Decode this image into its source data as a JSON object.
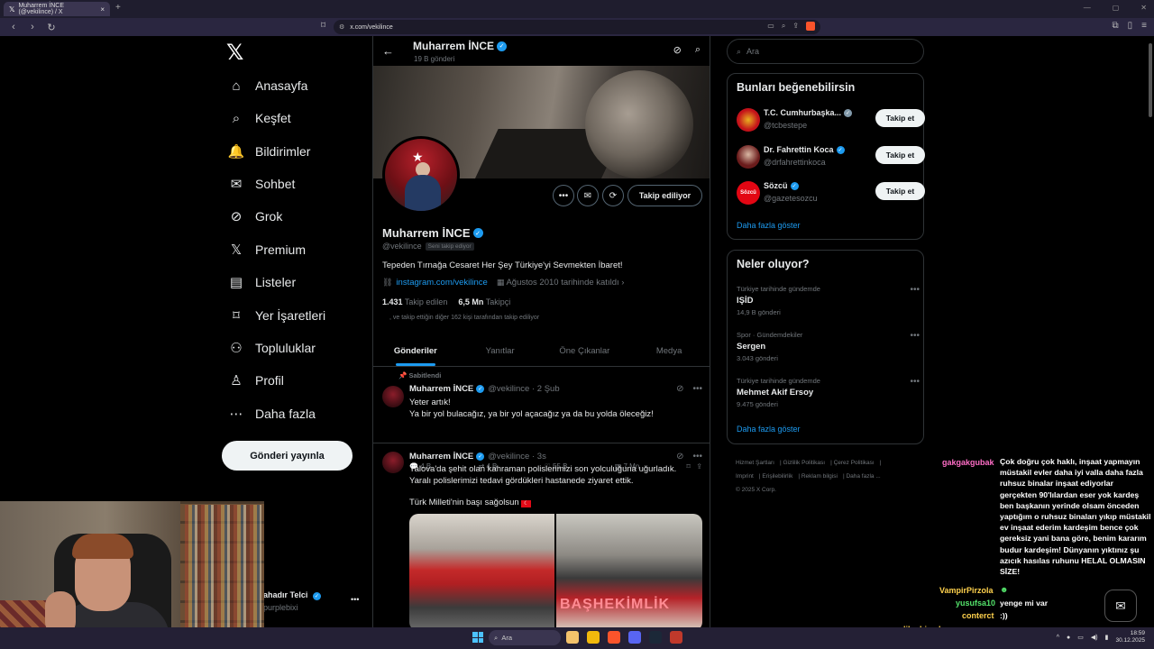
{
  "browser": {
    "tab_title": "Muharrem İNCE (@vekilince) / X",
    "url": "x.com/vekilince"
  },
  "nav": {
    "items": [
      {
        "label": "Anasayfa",
        "icon": "home-icon"
      },
      {
        "label": "Keşfet",
        "icon": "search-icon"
      },
      {
        "label": "Bildirimler",
        "icon": "bell-icon"
      },
      {
        "label": "Sohbet",
        "icon": "mail-icon"
      },
      {
        "label": "Grok",
        "icon": "grok-icon"
      },
      {
        "label": "Premium",
        "icon": "x-icon"
      },
      {
        "label": "Listeler",
        "icon": "list-icon"
      },
      {
        "label": "Yer İşaretleri",
        "icon": "bookmark-icon"
      },
      {
        "label": "Topluluklar",
        "icon": "community-icon"
      },
      {
        "label": "Profil",
        "icon": "person-icon"
      },
      {
        "label": "Daha fazla",
        "icon": "more-circle-icon"
      }
    ],
    "post_label": "Gönderi yayınla",
    "account_name": "ahadır Telci",
    "account_handle": "purplebixi"
  },
  "profile": {
    "name": "Muharrem İNCE",
    "posts_count": "19 B gönderi",
    "handle": "@vekilince",
    "follows_you": "Seni takip ediyor",
    "follow_label": "Takip ediliyor",
    "bio": "Tepeden Tırnağa Cesaret Her Şey Türkiye'yi Sevmekten İbaret!",
    "link": "instagram.com/vekilince",
    "joined": "Ağustos 2010 tarihinde katıldı",
    "following_count": "1.431",
    "following_label": "Takip edilen",
    "followers_count": "6,5 Mn",
    "followers_label": "Takipçi",
    "followed_by": ", ve takip ettiğin diğer 162 kişi tarafından takip ediliyor"
  },
  "tabs": [
    "Gönderiler",
    "Yanıtlar",
    "Öne Çıkanlar",
    "Medya"
  ],
  "tweets": [
    {
      "pinned": "Sabitlendi",
      "name": "Muharrem İNCE",
      "handle": "@vekilince · 2 Şub",
      "line1": "Yeter artık!",
      "line2": "Ya bir yol bulacağız, ya bir yol açacağız ya da bu yolda öleceğiz!",
      "replies": "4 B",
      "reposts": "4 B",
      "likes": "55 B",
      "views": "7 Mn"
    },
    {
      "name": "Muharrem İNCE",
      "handle": "@vekilince · 3s",
      "line1": "Yalova'da şehit olan kahraman polislerimizi son yolculuğuna uğurladık.",
      "line2": "Yaralı polislerimizi tedavi gördükleri hastanede ziyaret ettik.",
      "line3": "Türk Milleti'nin başı sağolsun",
      "media_sign": "BAŞHEKİMLİK"
    }
  ],
  "right": {
    "search_placeholder": "Ara",
    "suggest_title": "Bunları beğenebilirsin",
    "suggestions": [
      {
        "name": "T.C. Cumhurbaşka...",
        "handle": "@tcbestepe",
        "btn": "Takip et"
      },
      {
        "name": "Dr. Fahrettin Koca",
        "handle": "@drfahrettinkoca",
        "btn": "Takip et"
      },
      {
        "name": "Sözcü",
        "handle": "@gazetesozcu",
        "btn": "Takip et"
      }
    ],
    "show_more": "Daha fazla göster",
    "trends_title": "Neler oluyor?",
    "trends": [
      {
        "context": "Türkiye tarihinde gündemde",
        "topic": "IŞİD",
        "count": "14,9 B gönderi"
      },
      {
        "context": "Spor · Gündemdekiler",
        "topic": "Sergen",
        "count": "3.043 gönderi"
      },
      {
        "context": "Türkiye tarihinde gündemde",
        "topic": "Mehmet Akif Ersoy",
        "count": "9.475 gönderi"
      }
    ],
    "footer_line1": [
      "Hizmet Şartları",
      "Gizlilik Politikası",
      "Çerez Politikası"
    ],
    "footer_line2": [
      "Imprint",
      "Erişilebilirlik",
      "Reklam bilgisi",
      "Daha fazla ..."
    ],
    "copyright": "© 2025 X Corp."
  },
  "chat": [
    {
      "user": "gakgakgubak",
      "color": "#ff6ec7",
      "msg": "Çok doğru çok haklı, inşaat yapmayın müstakil evler daha iyi valla daha fazla ruhsuz binalar inşaat ediyorlar gerçekten 90'lılardan eser yok kardeş ben başkanın yerinde olsam önceden yaptığım o ruhsuz binaları yıkıp müstakil ev inşaat ederim kardeşim bence çok gereksiz yani bana göre, benim kararım budur kardeşim! Dünyanın yıktınız şu azıcık hasılas ruhunu HELAL OLMASIN SİZE!"
    },
    {
      "user": "VampirPirzola",
      "color": "#ffd24d",
      "msg": ""
    },
    {
      "user": "yusufsa10",
      "color": "#54e36b",
      "msg": "yenge mi var"
    },
    {
      "user": "conterct",
      "color": "#ffd24d",
      "msg": ":))"
    },
    {
      "user": "diloshimabensorunm...",
      "color": "#ffd24d",
      "msg": ""
    }
  ],
  "taskbar": {
    "search": "Ara",
    "time": "18:59",
    "date": "30.12.2025"
  }
}
